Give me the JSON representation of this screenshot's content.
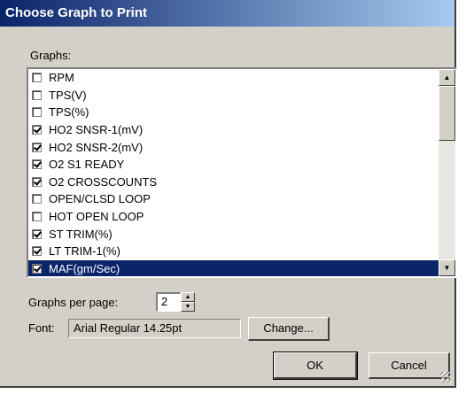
{
  "window": {
    "title": "Choose Graph to Print"
  },
  "graphs_label": "Graphs:",
  "graphs": [
    {
      "label": "RPM",
      "checked": false
    },
    {
      "label": "TPS(V)",
      "checked": false
    },
    {
      "label": "TPS(%)",
      "checked": false
    },
    {
      "label": "HO2 SNSR-1(mV)",
      "checked": true
    },
    {
      "label": "HO2 SNSR-2(mV)",
      "checked": true
    },
    {
      "label": "O2 S1 READY",
      "checked": true
    },
    {
      "label": "O2 CROSSCOUNTS",
      "checked": true
    },
    {
      "label": "OPEN/CLSD LOOP",
      "checked": false
    },
    {
      "label": "HOT OPEN LOOP",
      "checked": false
    },
    {
      "label": "ST TRIM(%)",
      "checked": true
    },
    {
      "label": "LT TRIM-1(%)",
      "checked": true
    },
    {
      "label": "MAF(gm/Sec)",
      "checked": true,
      "selected": true
    }
  ],
  "graphs_per_page": {
    "label": "Graphs per page:",
    "value": "2"
  },
  "font": {
    "label": "Font:",
    "value": "Arial Regular 14.25pt",
    "change_label": "Change..."
  },
  "buttons": {
    "ok": "OK",
    "cancel": "Cancel"
  },
  "colors": {
    "selection": "#0a246a",
    "dialog_bg": "#d4d0c8"
  }
}
